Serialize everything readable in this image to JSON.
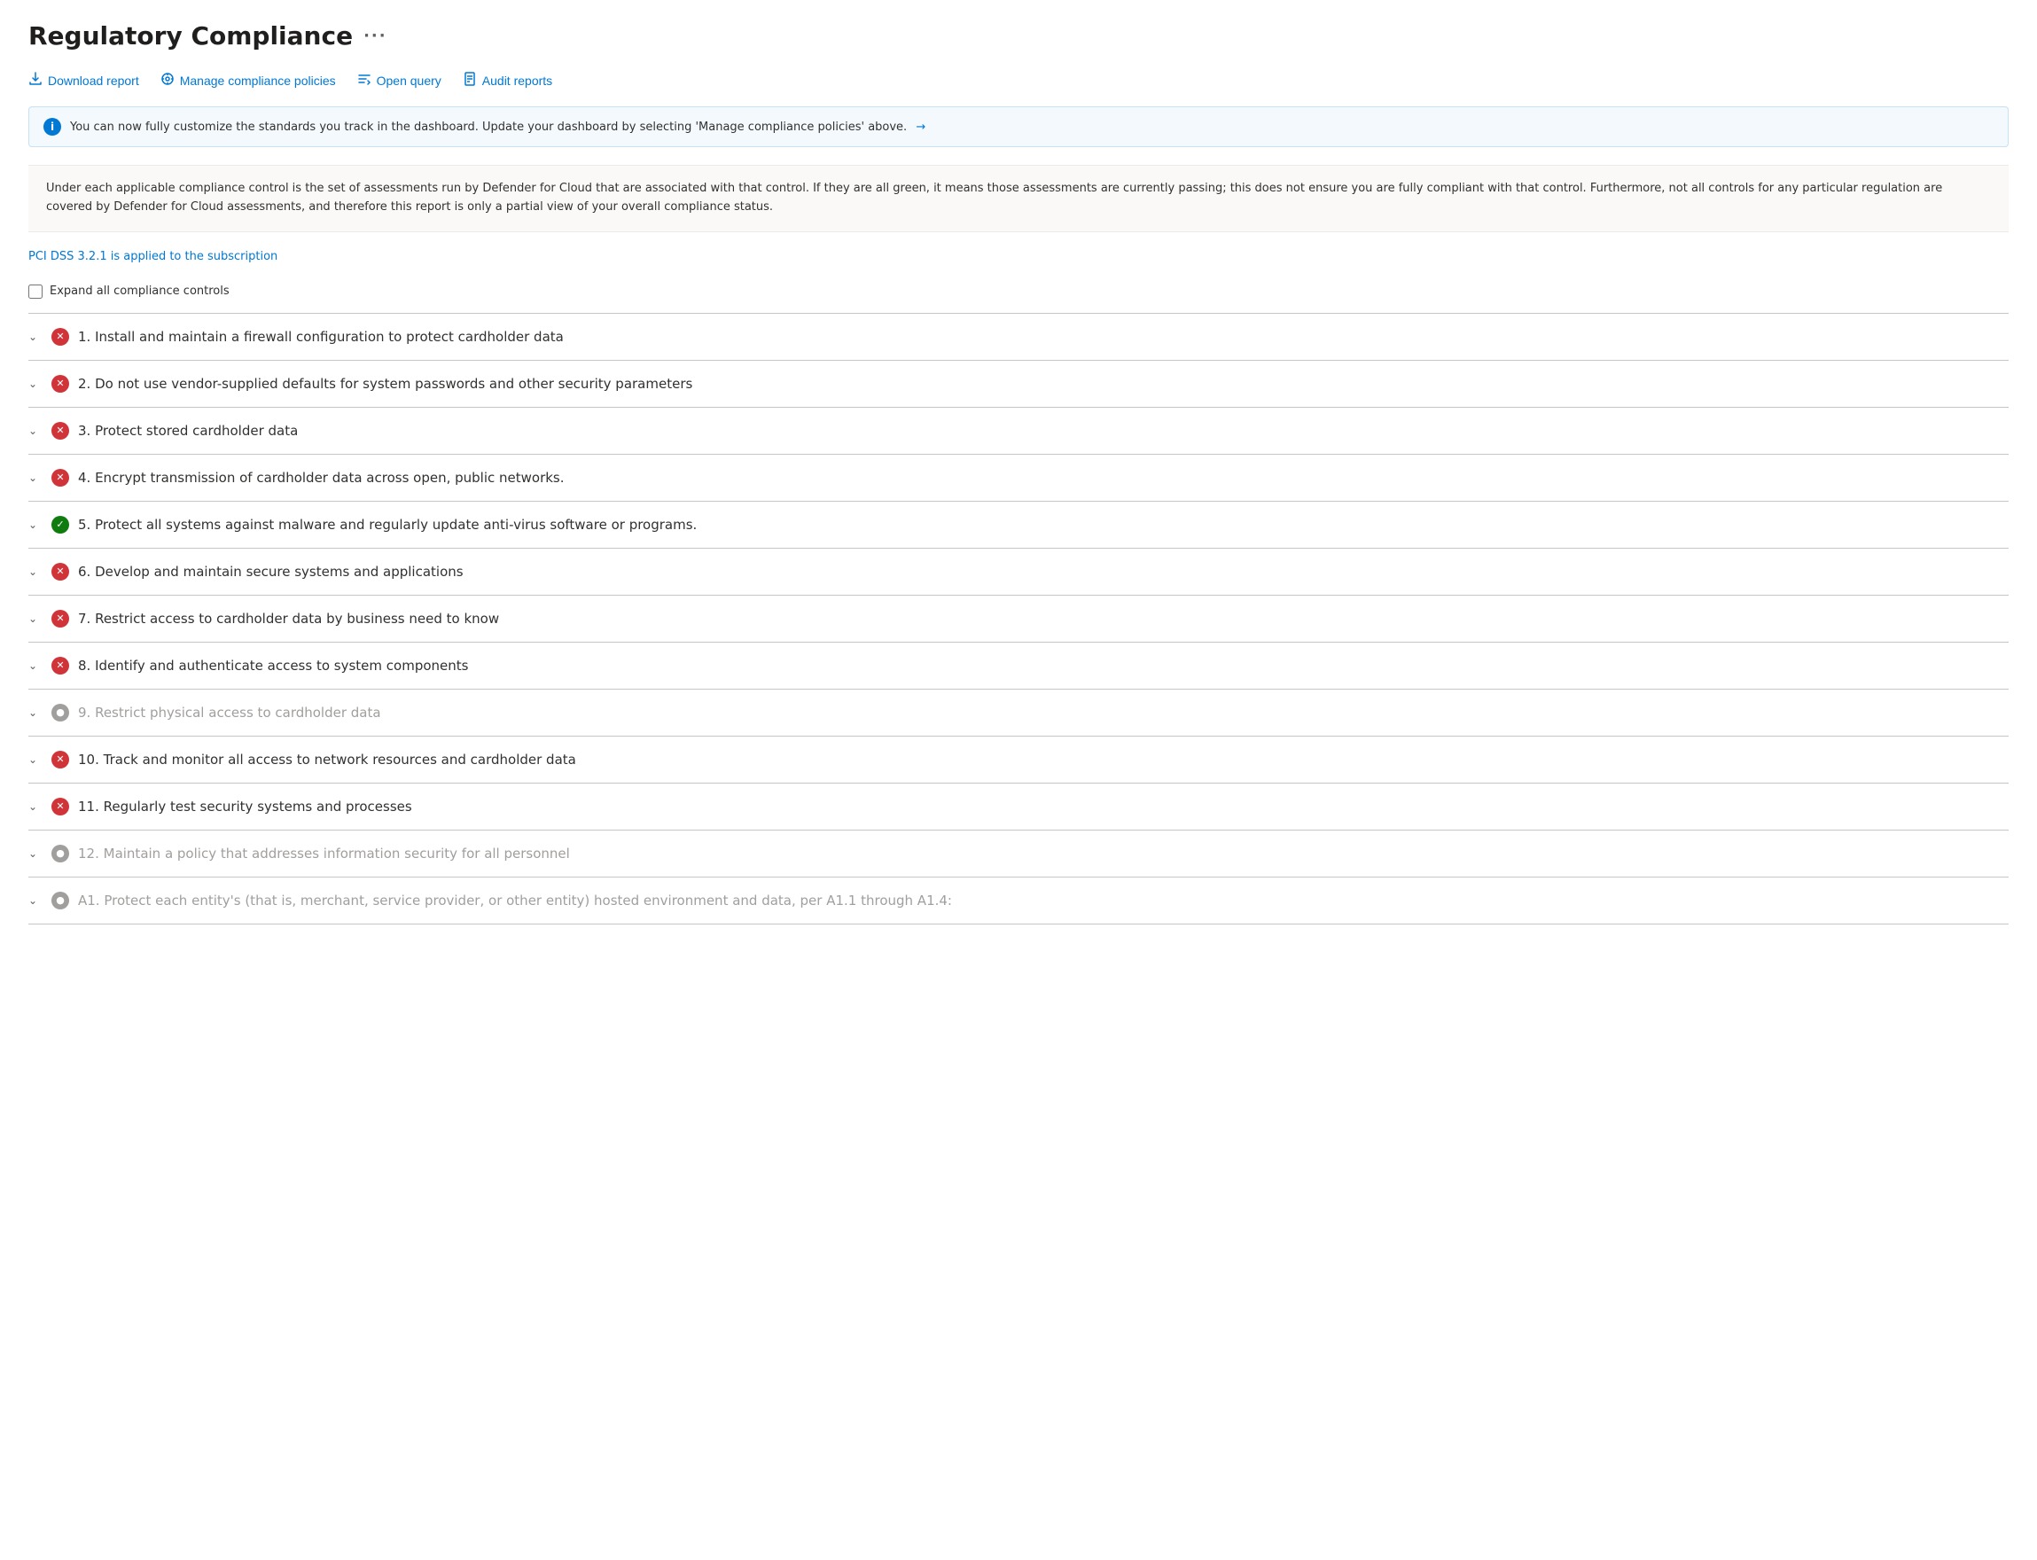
{
  "page": {
    "title": "Regulatory Compliance",
    "ellipsis": "···"
  },
  "toolbar": {
    "download_label": "Download report",
    "manage_label": "Manage compliance policies",
    "query_label": "Open query",
    "audit_label": "Audit reports"
  },
  "banner": {
    "text": "You can now fully customize the standards you track in the dashboard. Update your dashboard by selecting 'Manage compliance policies' above.",
    "arrow": "→"
  },
  "description": "Under each applicable compliance control is the set of assessments run by Defender for Cloud that are associated with that control. If they are all green, it means those assessments are currently passing; this does not ensure you are fully compliant with that control. Furthermore, not all controls for any particular regulation are covered by Defender for Cloud assessments, and therefore this report is only a partial view of your overall compliance status.",
  "pci_link": "PCI DSS 3.2.1 is applied to the subscription",
  "expand_all_label": "Expand all compliance controls",
  "compliance_items": [
    {
      "id": 1,
      "label": "1. Install and maintain a firewall configuration to protect cardholder data",
      "status": "error",
      "grayed": false
    },
    {
      "id": 2,
      "label": "2. Do not use vendor-supplied defaults for system passwords and other security parameters",
      "status": "error",
      "grayed": false
    },
    {
      "id": 3,
      "label": "3. Protect stored cardholder data",
      "status": "error",
      "grayed": false
    },
    {
      "id": 4,
      "label": "4. Encrypt transmission of cardholder data across open, public networks.",
      "status": "error",
      "grayed": false
    },
    {
      "id": 5,
      "label": "5. Protect all systems against malware and regularly update anti-virus software or programs.",
      "status": "success",
      "grayed": false
    },
    {
      "id": 6,
      "label": "6. Develop and maintain secure systems and applications",
      "status": "error",
      "grayed": false
    },
    {
      "id": 7,
      "label": "7. Restrict access to cardholder data by business need to know",
      "status": "error",
      "grayed": false
    },
    {
      "id": 8,
      "label": "8. Identify and authenticate access to system components",
      "status": "error",
      "grayed": false
    },
    {
      "id": 9,
      "label": "9. Restrict physical access to cardholder data",
      "status": "neutral",
      "grayed": true
    },
    {
      "id": 10,
      "label": "10. Track and monitor all access to network resources and cardholder data",
      "status": "error",
      "grayed": false
    },
    {
      "id": 11,
      "label": "11. Regularly test security systems and processes",
      "status": "error",
      "grayed": false
    },
    {
      "id": 12,
      "label": "12. Maintain a policy that addresses information security for all personnel",
      "status": "neutral",
      "grayed": true
    },
    {
      "id": 13,
      "label": "A1. Protect each entity's (that is, merchant, service provider, or other entity) hosted environment and data, per A1.1 through A1.4:",
      "status": "neutral",
      "grayed": true
    }
  ]
}
